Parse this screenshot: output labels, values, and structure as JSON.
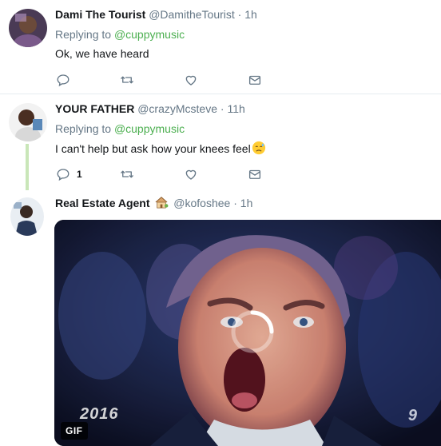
{
  "colors": {
    "accent_green": "#4caf50",
    "thread_line": "#c9e6b8",
    "muted_text": "#657786",
    "primary_text": "#14171a",
    "divider": "#e6ecf0"
  },
  "tweets": [
    {
      "name": "Dami The Tourist",
      "handle": "@DamitheTourist",
      "separator": "·",
      "time": "1h",
      "replying_prefix": "Replying to",
      "replying_to": "@cuppymusic",
      "text": "Ok, we have heard",
      "reply_count": "",
      "icons": [
        "reply-icon",
        "retweet-icon",
        "like-icon",
        "direct-message-icon"
      ]
    },
    {
      "name": "YOUR FATHER",
      "handle": "@crazyMcsteve",
      "separator": "·",
      "time": "11h",
      "replying_prefix": "Replying to",
      "replying_to": "@cuppymusic",
      "text": "I can't help but ask how your knees feel",
      "text_emoji": "disappointed-relieved-emoji",
      "reply_count": "1",
      "icons": [
        "reply-icon",
        "retweet-icon",
        "like-icon",
        "direct-message-icon"
      ]
    },
    {
      "name": "Real Estate Agent",
      "name_emoji": "house-with-garden-emoji",
      "handle": "@kofoshee",
      "separator": "·",
      "time": "1h",
      "media": {
        "badge": "GIF",
        "year_watermark": "2016",
        "channel_watermark": "9",
        "loading": "spinner"
      }
    }
  ]
}
